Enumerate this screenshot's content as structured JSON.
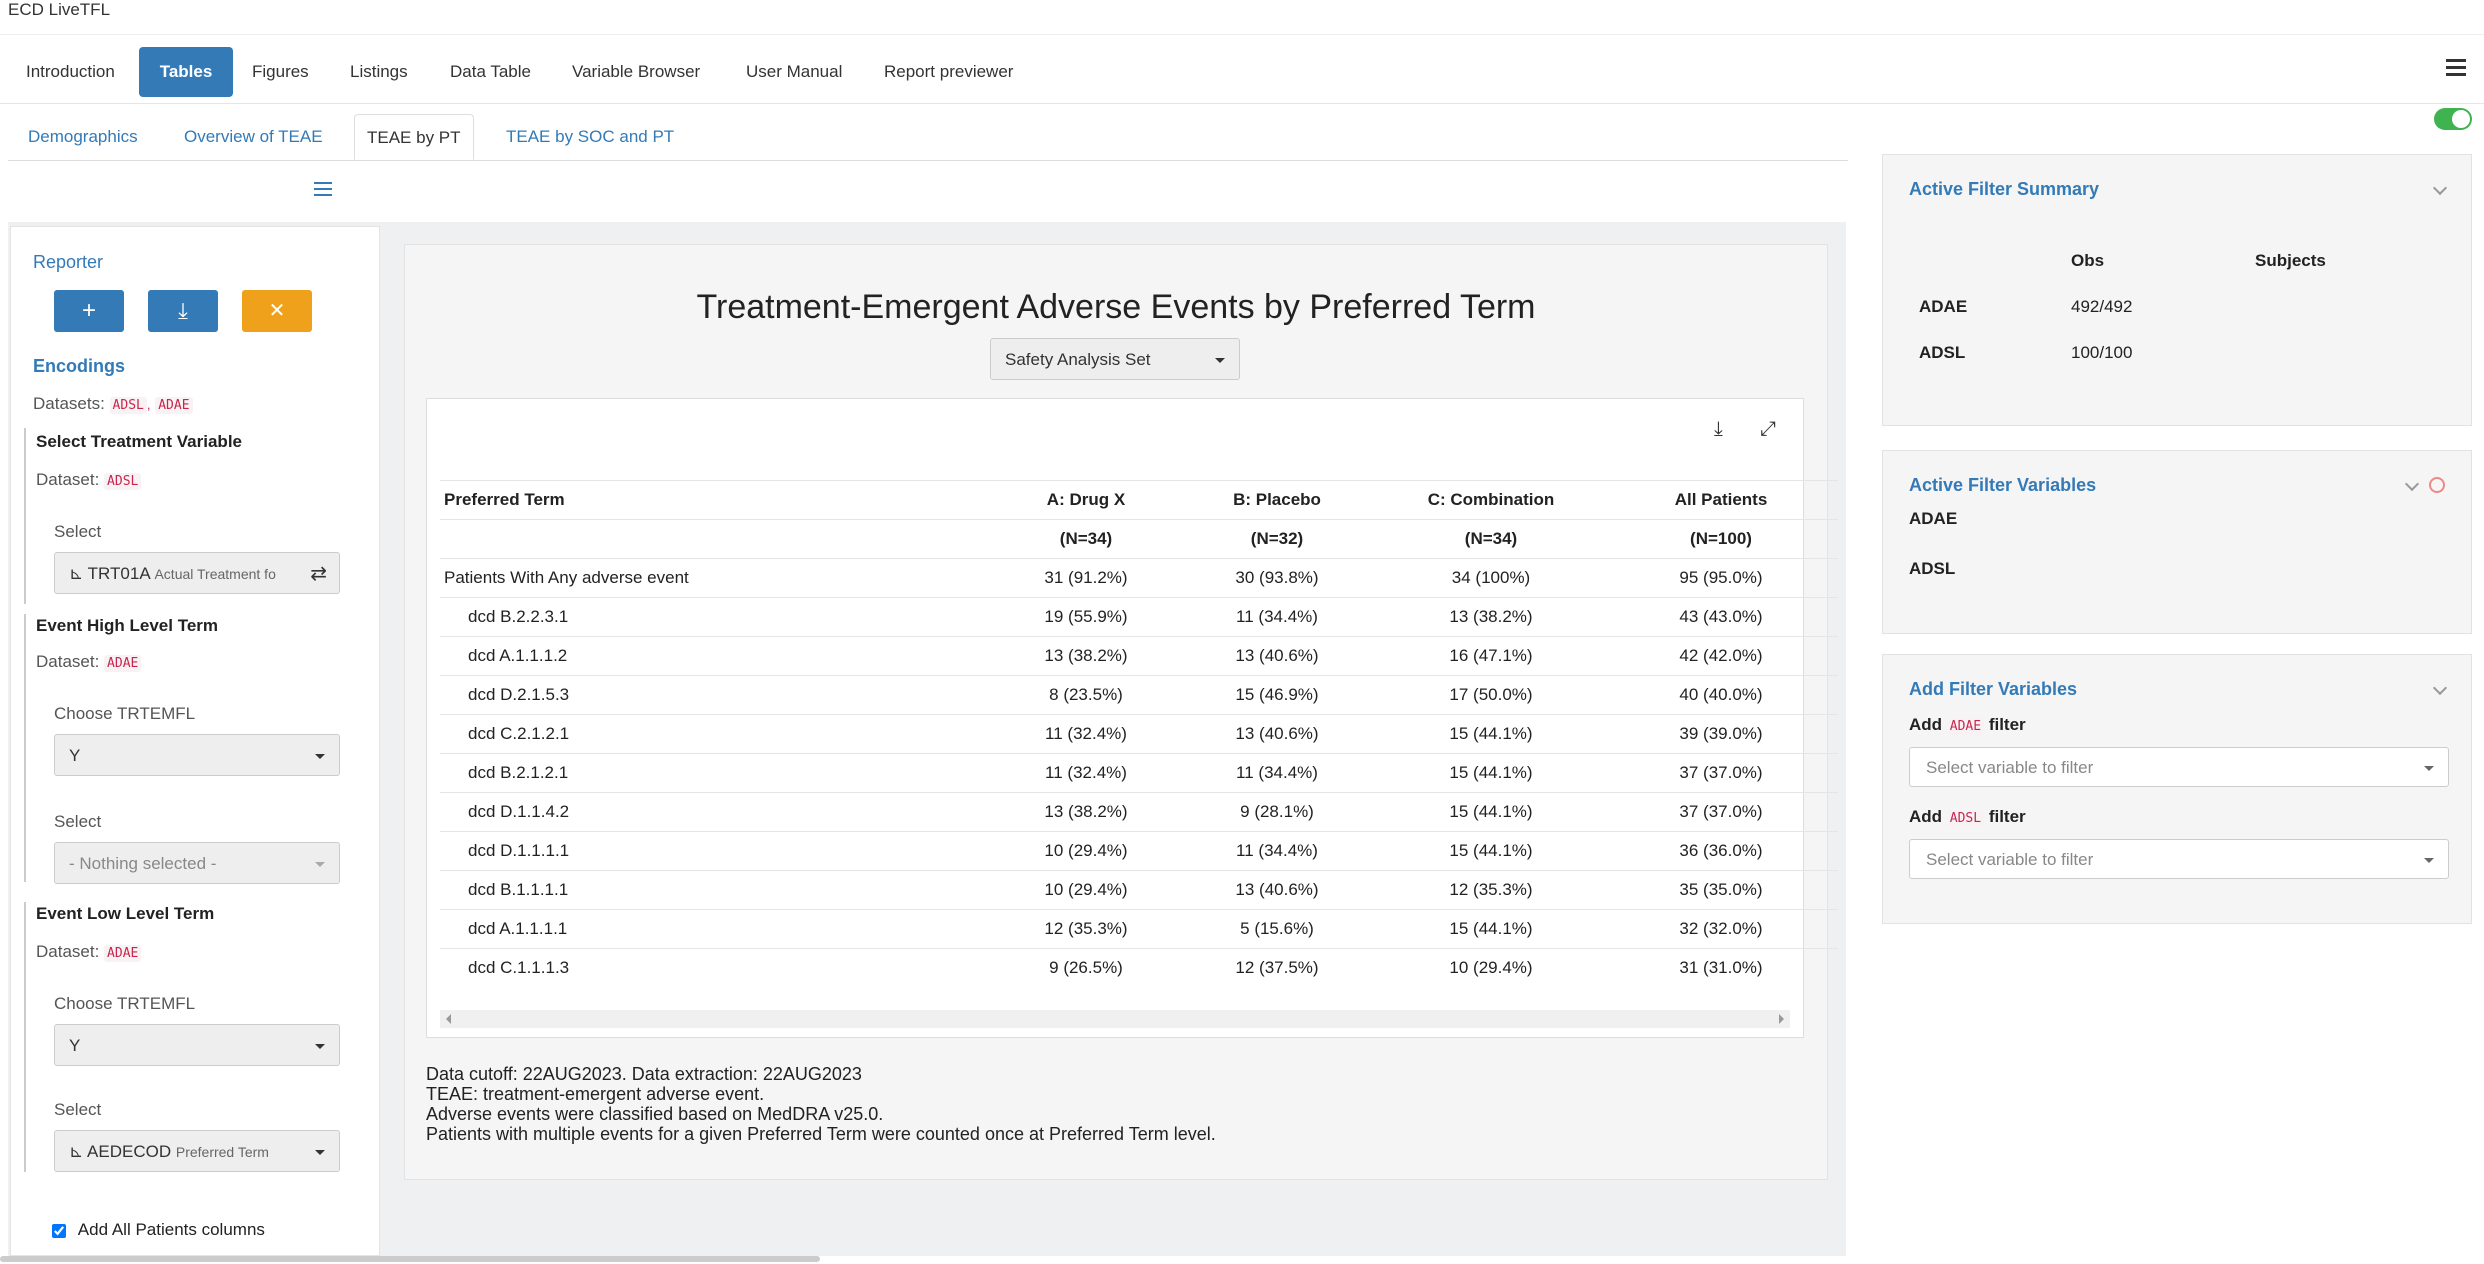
{
  "app": {
    "title": "ECD LiveTFL"
  },
  "nav": {
    "tabs": [
      "Introduction",
      "Tables",
      "Figures",
      "Listings",
      "Data Table",
      "Variable Browser",
      "User Manual",
      "Report previewer"
    ],
    "active": "Tables"
  },
  "subnav": {
    "tabs": [
      "Demographics",
      "Overview of TEAE",
      "TEAE by PT",
      "TEAE by SOC and PT"
    ],
    "active": "TEAE by PT"
  },
  "sidebar": {
    "reporter_label": "Reporter",
    "buttons": {
      "add": "+",
      "download": "⤓",
      "remove": "✕"
    },
    "encodings_label": "Encodings",
    "datasets_label": "Datasets:",
    "datasets": [
      "ADSL",
      "ADAE"
    ],
    "treatment": {
      "title": "Select Treatment Variable",
      "dataset_label": "Dataset:",
      "dataset": "ADSL",
      "select_label": "Select",
      "value": "TRT01A",
      "value_sub": "Actual Treatment fo"
    },
    "hlt": {
      "title": "Event High Level Term",
      "dataset_label": "Dataset:",
      "dataset": "ADAE",
      "choose_label": "Choose TRTEMFL",
      "choose_value": "Y",
      "select_label": "Select",
      "select_value": "- Nothing selected -"
    },
    "llt": {
      "title": "Event Low Level Term",
      "dataset_label": "Dataset:",
      "dataset": "ADAE",
      "choose_label": "Choose TRTEMFL",
      "choose_value": "Y",
      "select_label": "Select",
      "select_value": "AEDECOD",
      "select_sub": "Preferred Term"
    },
    "all_patients_label": "Add All Patients columns",
    "all_patients_checked": true
  },
  "main": {
    "title": "Treatment-Emergent Adverse Events by Preferred Term",
    "analysis_set": "Safety Analysis Set",
    "table": {
      "headers": [
        "Preferred Term",
        "A: Drug X",
        "B: Placebo",
        "C: Combination",
        "All Patients"
      ],
      "subheaders": [
        "",
        "(N=34)",
        "(N=32)",
        "(N=34)",
        "(N=100)"
      ],
      "rows": [
        [
          "Patients With Any adverse event",
          "31 (91.2%)",
          "30 (93.8%)",
          "34 (100%)",
          "95 (95.0%)"
        ],
        [
          "dcd B.2.2.3.1",
          "19 (55.9%)",
          "11 (34.4%)",
          "13 (38.2%)",
          "43 (43.0%)"
        ],
        [
          "dcd A.1.1.1.2",
          "13 (38.2%)",
          "13 (40.6%)",
          "16 (47.1%)",
          "42 (42.0%)"
        ],
        [
          "dcd D.2.1.5.3",
          "8 (23.5%)",
          "15 (46.9%)",
          "17 (50.0%)",
          "40 (40.0%)"
        ],
        [
          "dcd C.2.1.2.1",
          "11 (32.4%)",
          "13 (40.6%)",
          "15 (44.1%)",
          "39 (39.0%)"
        ],
        [
          "dcd B.2.1.2.1",
          "11 (32.4%)",
          "11 (34.4%)",
          "15 (44.1%)",
          "37 (37.0%)"
        ],
        [
          "dcd D.1.1.4.2",
          "13 (38.2%)",
          "9 (28.1%)",
          "15 (44.1%)",
          "37 (37.0%)"
        ],
        [
          "dcd D.1.1.1.1",
          "10 (29.4%)",
          "11 (34.4%)",
          "15 (44.1%)",
          "36 (36.0%)"
        ],
        [
          "dcd B.1.1.1.1",
          "10 (29.4%)",
          "13 (40.6%)",
          "12 (35.3%)",
          "35 (35.0%)"
        ],
        [
          "dcd A.1.1.1.1",
          "12 (35.3%)",
          "5 (15.6%)",
          "15 (44.1%)",
          "32 (32.0%)"
        ],
        [
          "dcd C.1.1.1.3",
          "9 (26.5%)",
          "12 (37.5%)",
          "10 (29.4%)",
          "31 (31.0%)"
        ]
      ]
    },
    "footnotes": [
      "Data cutoff: 22AUG2023. Data extraction: 22AUG2023",
      "TEAE: treatment-emergent adverse event.",
      "Adverse events were classified based on MedDRA v25.0.",
      "Patients with multiple events for a given Preferred Term were counted once at Preferred Term level."
    ]
  },
  "filters": {
    "summary": {
      "title": "Active Filter Summary",
      "col_obs": "Obs",
      "col_subjects": "Subjects",
      "rows": [
        {
          "name": "ADAE",
          "obs": "492/492",
          "subjects": ""
        },
        {
          "name": "ADSL",
          "obs": "100/100",
          "subjects": ""
        }
      ]
    },
    "active": {
      "title": "Active Filter Variables",
      "datasets": [
        "ADAE",
        "ADSL"
      ]
    },
    "add": {
      "title": "Add Filter Variables",
      "add_word": "Add",
      "filter_word": "filter",
      "items": [
        {
          "dataset": "ADAE",
          "placeholder": "Select variable to filter"
        },
        {
          "dataset": "ADSL",
          "placeholder": "Select variable to filter"
        }
      ]
    }
  },
  "colors": {
    "primary": "#337ab7",
    "warning": "#f0a11c",
    "toggle_on": "#3fb34f"
  }
}
